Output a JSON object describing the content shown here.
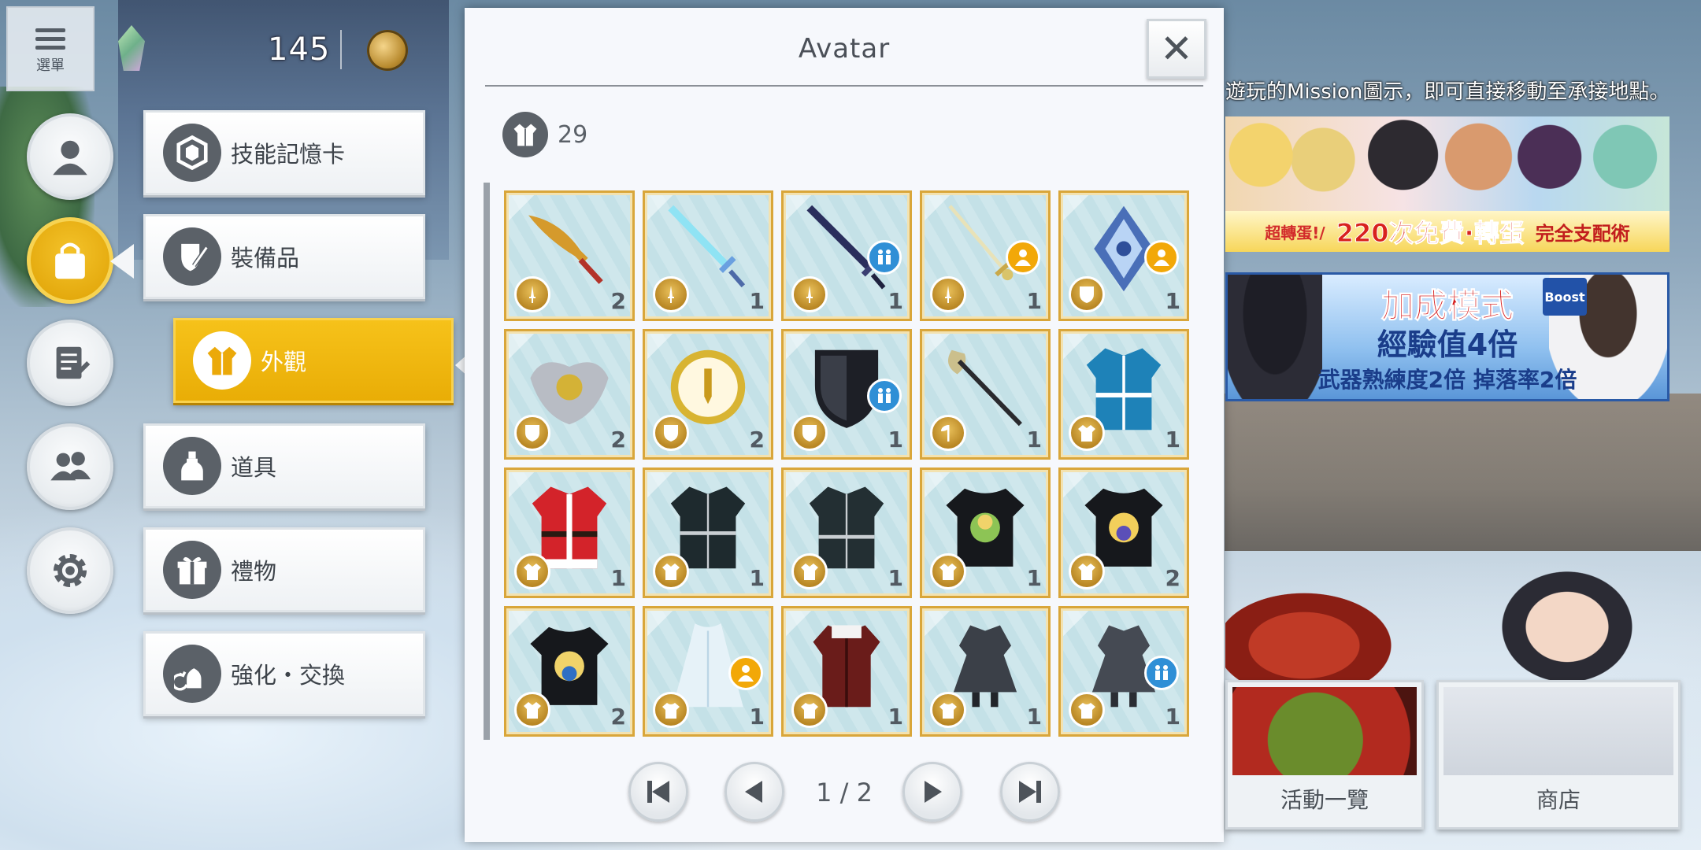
{
  "hud": {
    "menu_label": "選單",
    "crystal_count": "145"
  },
  "side_menu": [
    {
      "id": "profile",
      "icon": "user-icon"
    },
    {
      "id": "items",
      "icon": "bag-icon",
      "active": true
    },
    {
      "id": "quests",
      "icon": "notebook-icon"
    },
    {
      "id": "friends",
      "icon": "friends-icon"
    },
    {
      "id": "settings",
      "icon": "gear-icon"
    }
  ],
  "categories": {
    "c0": {
      "label": "技能記憶卡",
      "icon": "hexagon-card-icon"
    },
    "c1": {
      "label": "裝備品",
      "icon": "shield-sword-icon"
    },
    "c2": {
      "label": "外觀",
      "icon": "coat-icon",
      "active": true
    },
    "c3": {
      "label": "道具",
      "icon": "bottle-icon"
    },
    "c4": {
      "label": "禮物",
      "icon": "gift-icon"
    },
    "c5": {
      "label": "強化・交換",
      "icon": "enhance-exchange-icon"
    }
  },
  "panel": {
    "title": "Avatar",
    "item_count": "29",
    "page": "1 / 2"
  },
  "items": [
    {
      "art": "greatsword-gold",
      "type": "sword",
      "qty": "2"
    },
    {
      "art": "ice-sword",
      "type": "sword",
      "qty": "1"
    },
    {
      "art": "dark-longsword",
      "type": "sword",
      "qty": "1",
      "badge": "pair"
    },
    {
      "art": "rapier",
      "type": "sword",
      "qty": "1",
      "badge": "solo"
    },
    {
      "art": "crystal-shield",
      "type": "shield",
      "qty": "1",
      "badge": "solo"
    },
    {
      "art": "winged-shield",
      "type": "shield",
      "qty": "2"
    },
    {
      "art": "gold-round-shield",
      "type": "shield",
      "qty": "2"
    },
    {
      "art": "black-shield",
      "type": "shield",
      "qty": "1",
      "badge": "pair"
    },
    {
      "art": "axe",
      "type": "axe",
      "qty": "1"
    },
    {
      "art": "blue-uniform",
      "type": "coat",
      "qty": "1"
    },
    {
      "art": "santa-coat",
      "type": "coat",
      "qty": "1"
    },
    {
      "art": "black-uniform",
      "type": "coat",
      "qty": "1"
    },
    {
      "art": "black-uniform-2",
      "type": "coat",
      "qty": "1"
    },
    {
      "art": "black-tshirt-leafa",
      "type": "coat",
      "qty": "1"
    },
    {
      "art": "black-tshirt-alice",
      "type": "coat",
      "qty": "2"
    },
    {
      "art": "black-tshirt-eugeo",
      "type": "coat",
      "qty": "2"
    },
    {
      "art": "white-dress",
      "type": "shirt",
      "qty": "1",
      "badge": "solo"
    },
    {
      "art": "red-outfit",
      "type": "shirt",
      "qty": "1"
    },
    {
      "art": "dark-skirt-uniform",
      "type": "shirt",
      "qty": "1"
    },
    {
      "art": "dark-skirt-uniform-2",
      "type": "shirt",
      "qty": "1",
      "badge": "pair"
    }
  ],
  "right": {
    "notice": "遊玩的Mission圖示，即可直接移動至承接地點。",
    "banner1": {
      "s1": "超轉蛋!/",
      "s2": "220次免費·轉蛋",
      "s3": "完全支配術"
    },
    "banner2": {
      "t1": "加成模式",
      "t2": "經驗值4倍",
      "t3": "武器熟練度2倍 掉落率2倍",
      "boost": "Boost"
    },
    "card_events": "活動一覽",
    "card_shop": "商店"
  },
  "colors": {
    "accent_gold": "#f2b50f",
    "badge_pair": "#2f8fd6",
    "badge_solo": "#f2a808",
    "tile_border": "#d9a63a"
  }
}
